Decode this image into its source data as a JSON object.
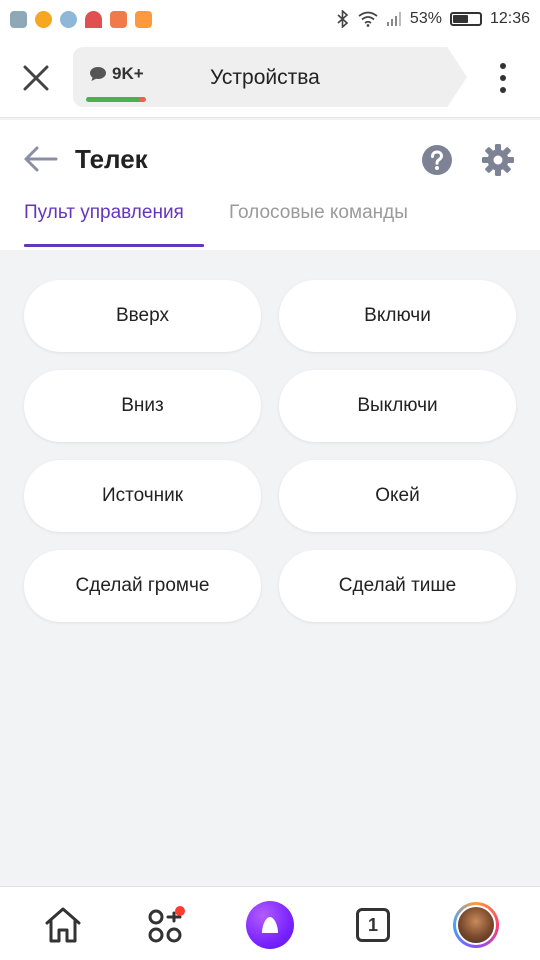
{
  "status_bar": {
    "battery": "53%",
    "battery_level": 0.53,
    "time": "12:36",
    "app_icons": [
      "b-icon",
      "weibo-icon",
      "telegram-icon",
      "umbrella-icon",
      "mail-icon",
      "orange-app-icon"
    ]
  },
  "top_bar": {
    "badge_count": "9K+",
    "title": "Устройства"
  },
  "page": {
    "title": "Телек",
    "tabs": [
      {
        "label": "Пульт управления",
        "active": true
      },
      {
        "label": "Голосовые команды",
        "active": false
      }
    ]
  },
  "commands": [
    {
      "label": "Вверх"
    },
    {
      "label": "Включи"
    },
    {
      "label": "Вниз"
    },
    {
      "label": "Выключи"
    },
    {
      "label": "Источник"
    },
    {
      "label": "Окей"
    },
    {
      "label": "Сделай громче"
    },
    {
      "label": "Сделай тише"
    }
  ],
  "bottom_nav": {
    "tabs_count": "1"
  },
  "colors": {
    "accent": "#6535bd",
    "page_bg": "#f2f3f5",
    "button_bg": "#ffffff",
    "alice": "#7a24ff",
    "notification_dot": "#ff3b30"
  }
}
